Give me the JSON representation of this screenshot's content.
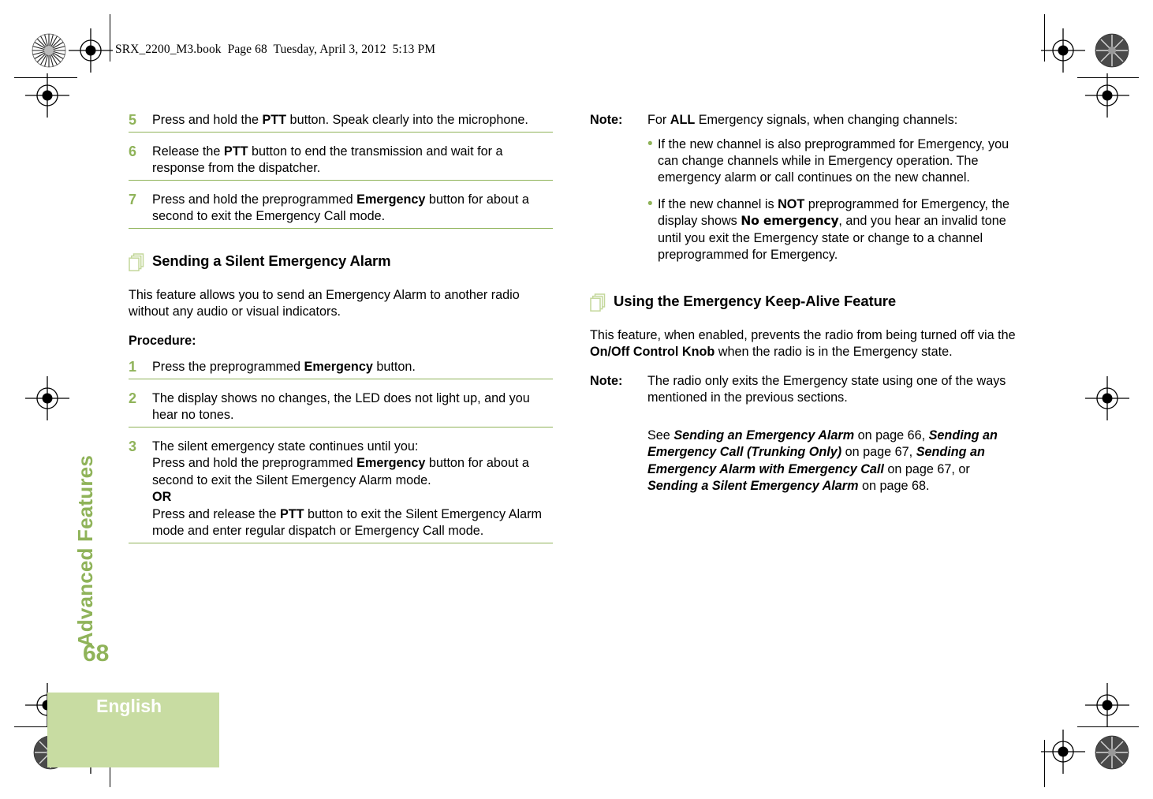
{
  "header": {
    "file_line": "SRX_2200_M3.book  Page 68  Tuesday, April 3, 2012  5:13 PM"
  },
  "side_tab": {
    "chapter_label": "Advanced Features",
    "folio": "68"
  },
  "footer": {
    "language": "English"
  },
  "colors": {
    "accent_green": "#8fb359",
    "footer_block": "#c8dca2",
    "icon_green": "#c3d79a"
  },
  "left_column": {
    "steps_continued": [
      {
        "number": "5",
        "runs": [
          {
            "text": "Press and hold the ",
            "style": "normal"
          },
          {
            "text": "PTT",
            "style": "bold"
          },
          {
            "text": " button. Speak clearly into the microphone.",
            "style": "normal"
          }
        ]
      },
      {
        "number": "6",
        "runs": [
          {
            "text": "Release the ",
            "style": "normal"
          },
          {
            "text": "PTT",
            "style": "bold"
          },
          {
            "text": " button to end the transmission and wait for a response from the dispatcher.",
            "style": "normal"
          }
        ]
      },
      {
        "number": "7",
        "runs": [
          {
            "text": "Press and hold the preprogrammed ",
            "style": "normal"
          },
          {
            "text": "Emergency",
            "style": "bold"
          },
          {
            "text": " button for about a second to exit the Emergency Call mode.",
            "style": "normal"
          }
        ]
      }
    ],
    "section": {
      "icon": "stacked-pages-icon",
      "title": "Sending a Silent Emergency Alarm",
      "intro": "This feature allows you to send an Emergency Alarm to another radio without any audio or visual indicators.",
      "procedure_label": "Procedure:"
    },
    "procedure_steps": [
      {
        "number": "1",
        "runs": [
          {
            "text": "Press the preprogrammed ",
            "style": "normal"
          },
          {
            "text": "Emergency",
            "style": "bold"
          },
          {
            "text": " button.",
            "style": "normal"
          }
        ]
      },
      {
        "number": "2",
        "runs": [
          {
            "text": "The display shows no changes, the LED does not light up, and you hear no tones.",
            "style": "normal"
          }
        ]
      },
      {
        "number": "3",
        "runs": [
          {
            "text": "The silent emergency state continues until you:",
            "style": "normal"
          },
          {
            "text": "BREAK",
            "style": "break"
          },
          {
            "text": "Press and hold the preprogrammed ",
            "style": "normal"
          },
          {
            "text": "Emergency",
            "style": "bold"
          },
          {
            "text": " button for about a second to exit the Silent Emergency Alarm mode.",
            "style": "normal"
          },
          {
            "text": "BREAK",
            "style": "break"
          },
          {
            "text": "OR",
            "style": "bold"
          },
          {
            "text": "BREAK",
            "style": "break"
          },
          {
            "text": "Press and release the ",
            "style": "normal"
          },
          {
            "text": "PTT",
            "style": "bold"
          },
          {
            "text": " button to exit the Silent Emergency Alarm mode and enter regular dispatch or Emergency Call mode.",
            "style": "normal"
          }
        ]
      }
    ]
  },
  "right_column": {
    "note_top": {
      "label": "Note:",
      "runs": [
        {
          "text": "For ",
          "style": "normal"
        },
        {
          "text": "ALL",
          "style": "bold"
        },
        {
          "text": " Emergency signals, when changing channels:",
          "style": "normal"
        }
      ],
      "bullets": [
        {
          "runs": [
            {
              "text": "If the new channel is also preprogrammed for Emergency, you can change channels while in Emergency operation. The emergency alarm or call continues on the new channel.",
              "style": "normal"
            }
          ]
        },
        {
          "runs": [
            {
              "text": "If the new channel is ",
              "style": "normal"
            },
            {
              "text": "NOT",
              "style": "bold"
            },
            {
              "text": " preprogrammed for Emergency, the display shows ",
              "style": "normal"
            },
            {
              "text": "No emergency",
              "style": "lcd"
            },
            {
              "text": ", and you hear an invalid tone until you exit the Emergency state or change to a channel preprogrammed for Emergency.",
              "style": "normal"
            }
          ]
        }
      ]
    },
    "section": {
      "icon": "stacked-pages-icon",
      "title": "Using the Emergency Keep-Alive Feature",
      "intro_runs": [
        {
          "text": "This feature, when enabled, prevents the radio from being turned off via the ",
          "style": "normal"
        },
        {
          "text": "On/Off Control Knob",
          "style": "bold"
        },
        {
          "text": " when the radio is in the Emergency state.",
          "style": "normal"
        }
      ]
    },
    "note_bottom": {
      "label": "Note:",
      "runs": [
        {
          "text": "The radio only exits the Emergency state using one of the ways mentioned in the previous sections.",
          "style": "normal"
        }
      ],
      "xref_runs": [
        {
          "text": "See ",
          "style": "normal"
        },
        {
          "text": "Sending an Emergency Alarm",
          "style": "bolditalic"
        },
        {
          "text": " on page 66, ",
          "style": "normal"
        },
        {
          "text": "Sending an Emergency Call (Trunking Only)",
          "style": "bolditalic"
        },
        {
          "text": " on page 67, ",
          "style": "normal"
        },
        {
          "text": "Sending an Emergency Alarm with Emergency Call",
          "style": "bolditalic"
        },
        {
          "text": " on page 67, or ",
          "style": "normal"
        },
        {
          "text": "Sending a Silent Emergency Alarm",
          "style": "bolditalic"
        },
        {
          "text": " on page 68.",
          "style": "normal"
        }
      ]
    }
  }
}
